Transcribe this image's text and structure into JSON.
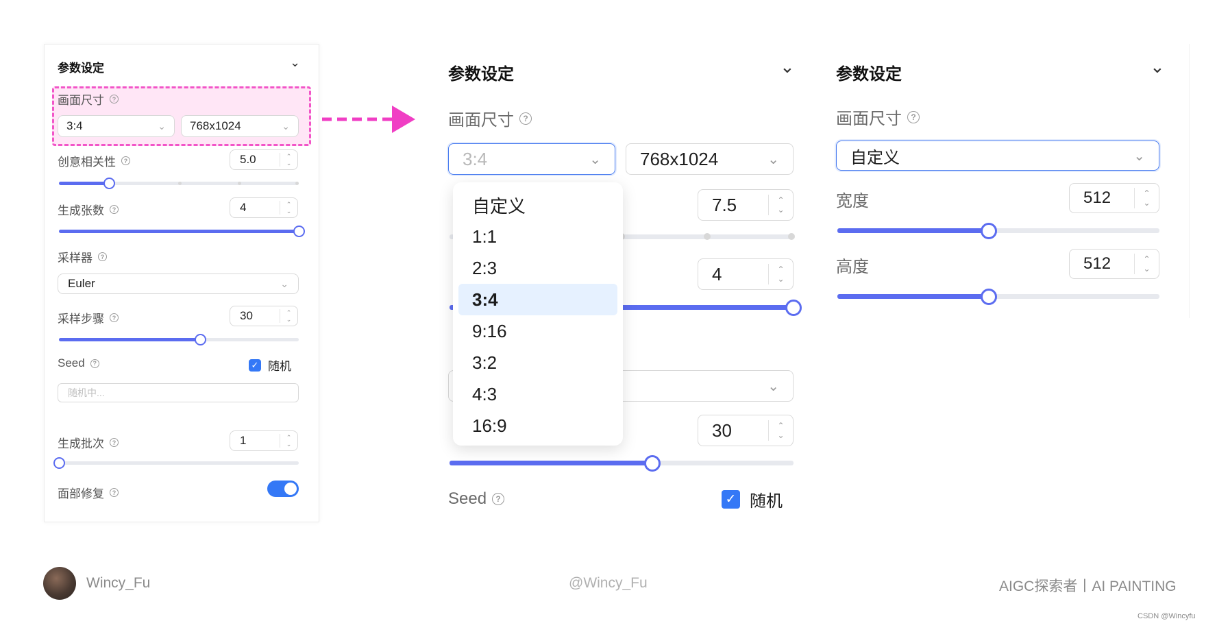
{
  "panel_small": {
    "title": "参数设定",
    "size_label": "画面尺寸",
    "ratio_value": "3:4",
    "size_value": "768x1024",
    "creativity_label": "创意相关性",
    "creativity_value": "5.0",
    "count_label": "生成张数",
    "count_value": "4",
    "sampler_label": "采样器",
    "sampler_value": "Euler",
    "steps_label": "采样步骤",
    "steps_value": "30",
    "seed_label": "Seed",
    "random_label": "随机",
    "seed_placeholder": "随机中...",
    "batch_label": "生成批次",
    "batch_value": "1",
    "face_label": "面部修复",
    "sliders": {
      "creativity_fraction": 0.21,
      "count_fraction": 1.0,
      "steps_fraction": 0.59,
      "batch_fraction": 0.0
    }
  },
  "panel_zoom": {
    "title": "参数设定",
    "size_label": "画面尺寸",
    "ratio_value": "3:4",
    "size_value": "768x1024",
    "creativity_value": "7.5",
    "count_value": "4",
    "steps_value": "30",
    "seed_label": "Seed",
    "random_label": "随机",
    "dropdown_options": [
      "自定义",
      "1:1",
      "2:3",
      "3:4",
      "9:16",
      "3:2",
      "4:3",
      "16:9"
    ],
    "dropdown_selected": "3:4",
    "sliders": {
      "count_fraction": 1.0,
      "steps_fraction": 0.59
    }
  },
  "panel_custom": {
    "title": "参数设定",
    "size_label": "画面尺寸",
    "ratio_value": "自定义",
    "width_label": "宽度",
    "width_value": "512",
    "height_label": "高度",
    "height_value": "512",
    "sliders": {
      "width_fraction": 0.47,
      "height_fraction": 0.47
    }
  },
  "footer": {
    "author": "Wincy_Fu",
    "handle": "@Wincy_Fu",
    "brand": "AIGC探索者丨AI PAINTING",
    "watermark": "CSDN @Wincyfu"
  },
  "colors": {
    "accent": "#5b6cf0",
    "checkbox": "#3478f6",
    "highlight_border": "#f255c8",
    "highlight_fill": "#ffe6f6",
    "arrow": "#f03ec4",
    "dropdown_selected_bg": "#e6f1ff"
  },
  "icons": {
    "chevron": "chevron-down-icon",
    "help": "question-circle-icon",
    "check": "checkmark-icon",
    "arrow": "dashed-arrow-right-icon"
  }
}
